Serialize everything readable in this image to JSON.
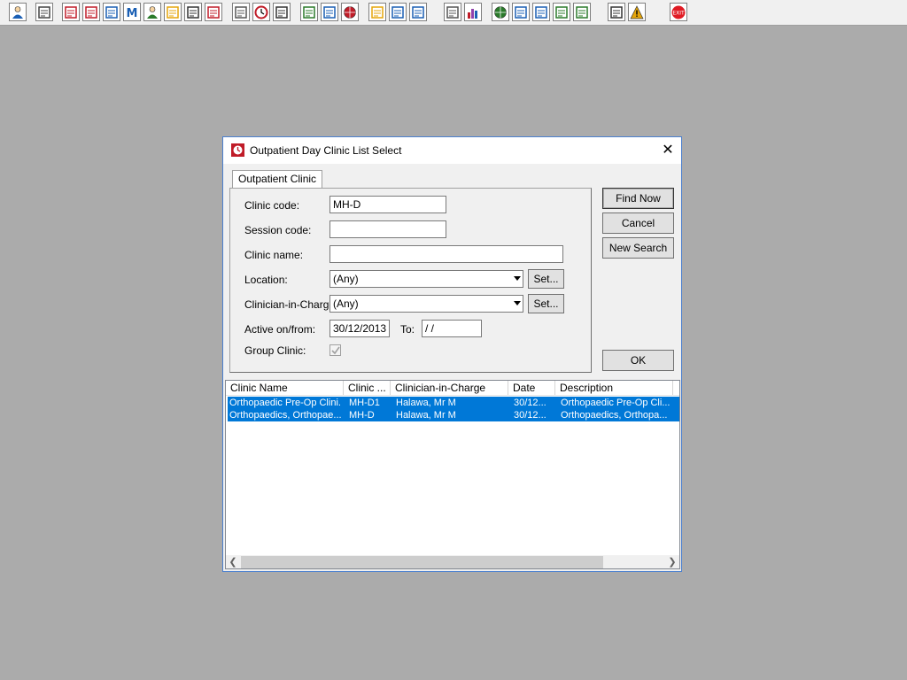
{
  "toolbar": {
    "buttons": [
      {
        "name": "person-icon",
        "color": "#1a5fb4"
      },
      {
        "name": "printer-icon",
        "color": "#444444"
      },
      {
        "name": "red-book-icon",
        "color": "#c01c28"
      },
      {
        "name": "form-edit-icon",
        "color": "#c01c28"
      },
      {
        "name": "list-icon",
        "color": "#1a5fb4"
      },
      {
        "name": "letter-m-icon",
        "color": "#1a5fb4"
      },
      {
        "name": "doctor-icon",
        "color": "#2a7a2a"
      },
      {
        "name": "notepad-icon",
        "color": "#e5a50a"
      },
      {
        "name": "flag-icon",
        "color": "#333333"
      },
      {
        "name": "flag-red-icon",
        "color": "#c01c28"
      },
      {
        "name": "envelope-icon",
        "color": "#555555"
      },
      {
        "name": "clock-icon",
        "color": "#c01c28"
      },
      {
        "name": "window-icon",
        "color": "#333333"
      },
      {
        "name": "chart-icon",
        "color": "#2a7a2a"
      },
      {
        "name": "screen-icon",
        "color": "#1a5fb4"
      },
      {
        "name": "refresh-icon",
        "color": "#c01c28"
      },
      {
        "name": "note-icon",
        "color": "#e5a50a"
      },
      {
        "name": "car-icon",
        "color": "#1a5fb4"
      },
      {
        "name": "ambulance-icon",
        "color": "#1a5fb4"
      },
      {
        "name": "document-icon",
        "color": "#555555"
      },
      {
        "name": "bar-chart-icon",
        "color": "#9141ac"
      },
      {
        "name": "globe-icon",
        "color": "#2a7a2a"
      },
      {
        "name": "check-list-icon",
        "color": "#1a5fb4"
      },
      {
        "name": "check-doc-icon",
        "color": "#1a5fb4"
      },
      {
        "name": "download-icon",
        "color": "#2a7a2a"
      },
      {
        "name": "upload-icon",
        "color": "#2a7a2a"
      },
      {
        "name": "transfer-icon",
        "color": "#333333"
      },
      {
        "name": "warning-icon",
        "color": "#e5a50a"
      },
      {
        "name": "exit-icon",
        "color": "#e01b24"
      }
    ]
  },
  "dialog": {
    "title": "Outpatient Day Clinic List Select",
    "tab": "Outpatient Clinic",
    "fields": {
      "clinic_code": {
        "label": "Clinic code:",
        "value": "MH-D"
      },
      "session_code": {
        "label": "Session code:",
        "value": ""
      },
      "clinic_name": {
        "label": "Clinic name:",
        "value": ""
      },
      "location": {
        "label": "Location:",
        "value": "(Any)"
      },
      "clinician": {
        "label": "Clinician-in-Charge:",
        "value": "(Any)"
      },
      "active_from": {
        "label": "Active on/from:",
        "value": "30/12/2013"
      },
      "to": {
        "label": "To:",
        "value": " /  /"
      },
      "group_clinic": {
        "label": "Group Clinic:",
        "checked": true
      }
    },
    "set_label": "Set...",
    "buttons": {
      "find_now": "Find Now",
      "cancel": "Cancel",
      "new_search": "New Search",
      "ok": "OK"
    },
    "list": {
      "headers": [
        "Clinic Name",
        "Clinic ...",
        "Clinician-in-Charge",
        "Date",
        "Description"
      ],
      "rows": [
        [
          "Orthopaedic Pre-Op Clini...",
          "MH-D1",
          "Halawa, Mr M",
          "30/12...",
          "Orthopaedic Pre-Op Cli..."
        ],
        [
          "Orthopaedics, Orthopae...",
          "MH-D",
          "Halawa, Mr M",
          "30/12...",
          "Orthopaedics, Orthopa..."
        ]
      ]
    }
  },
  "colors": {
    "selection": "#0078d7",
    "desktop": "#ababab",
    "dialog_border": "#4a7fcf"
  }
}
